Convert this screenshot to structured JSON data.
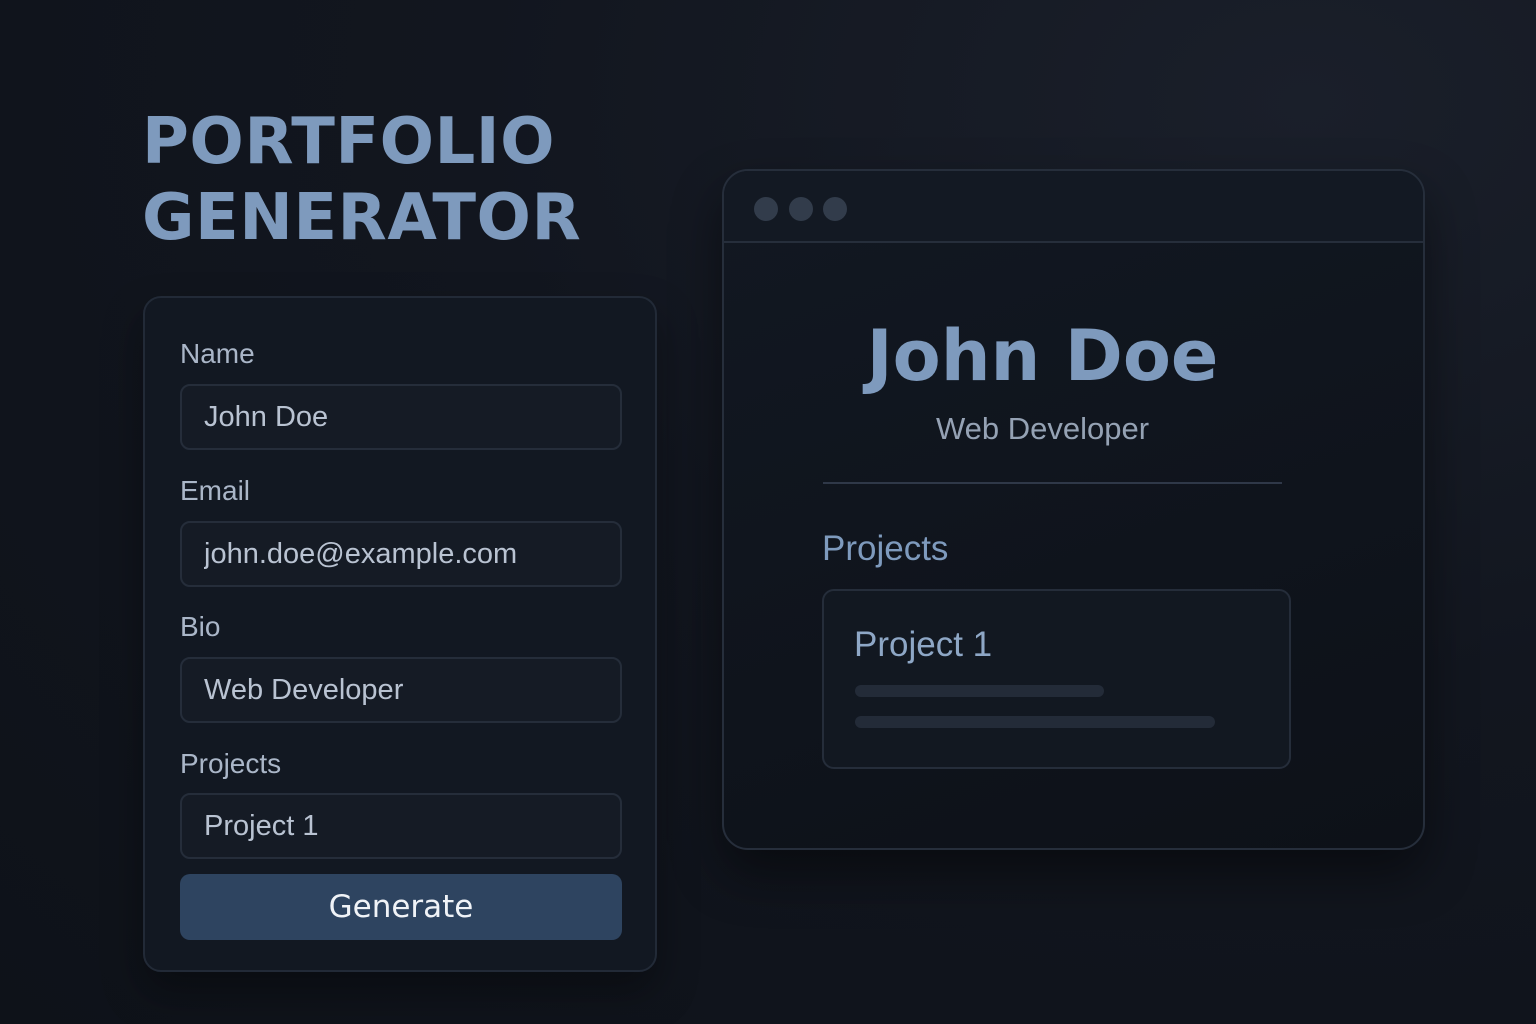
{
  "header": {
    "title_line1": "PORTFOLIO",
    "title_line2": "GENERATOR"
  },
  "form": {
    "name_label": "Name",
    "name_value": "John Doe",
    "email_label": "Email",
    "email_value": "john.doe@example.com",
    "bio_label": "Bio",
    "bio_value": "Web Developer",
    "projects_label": "Projects",
    "projects_value": "Project 1",
    "generate_label": "Generate"
  },
  "preview": {
    "name": "John Doe",
    "bio": "Web Developer",
    "projects_heading": "Projects",
    "projects": [
      {
        "title": "Project 1"
      }
    ]
  },
  "colors": {
    "accent": "#7e9abd",
    "button": "#2e4460",
    "background": "#12161f"
  }
}
